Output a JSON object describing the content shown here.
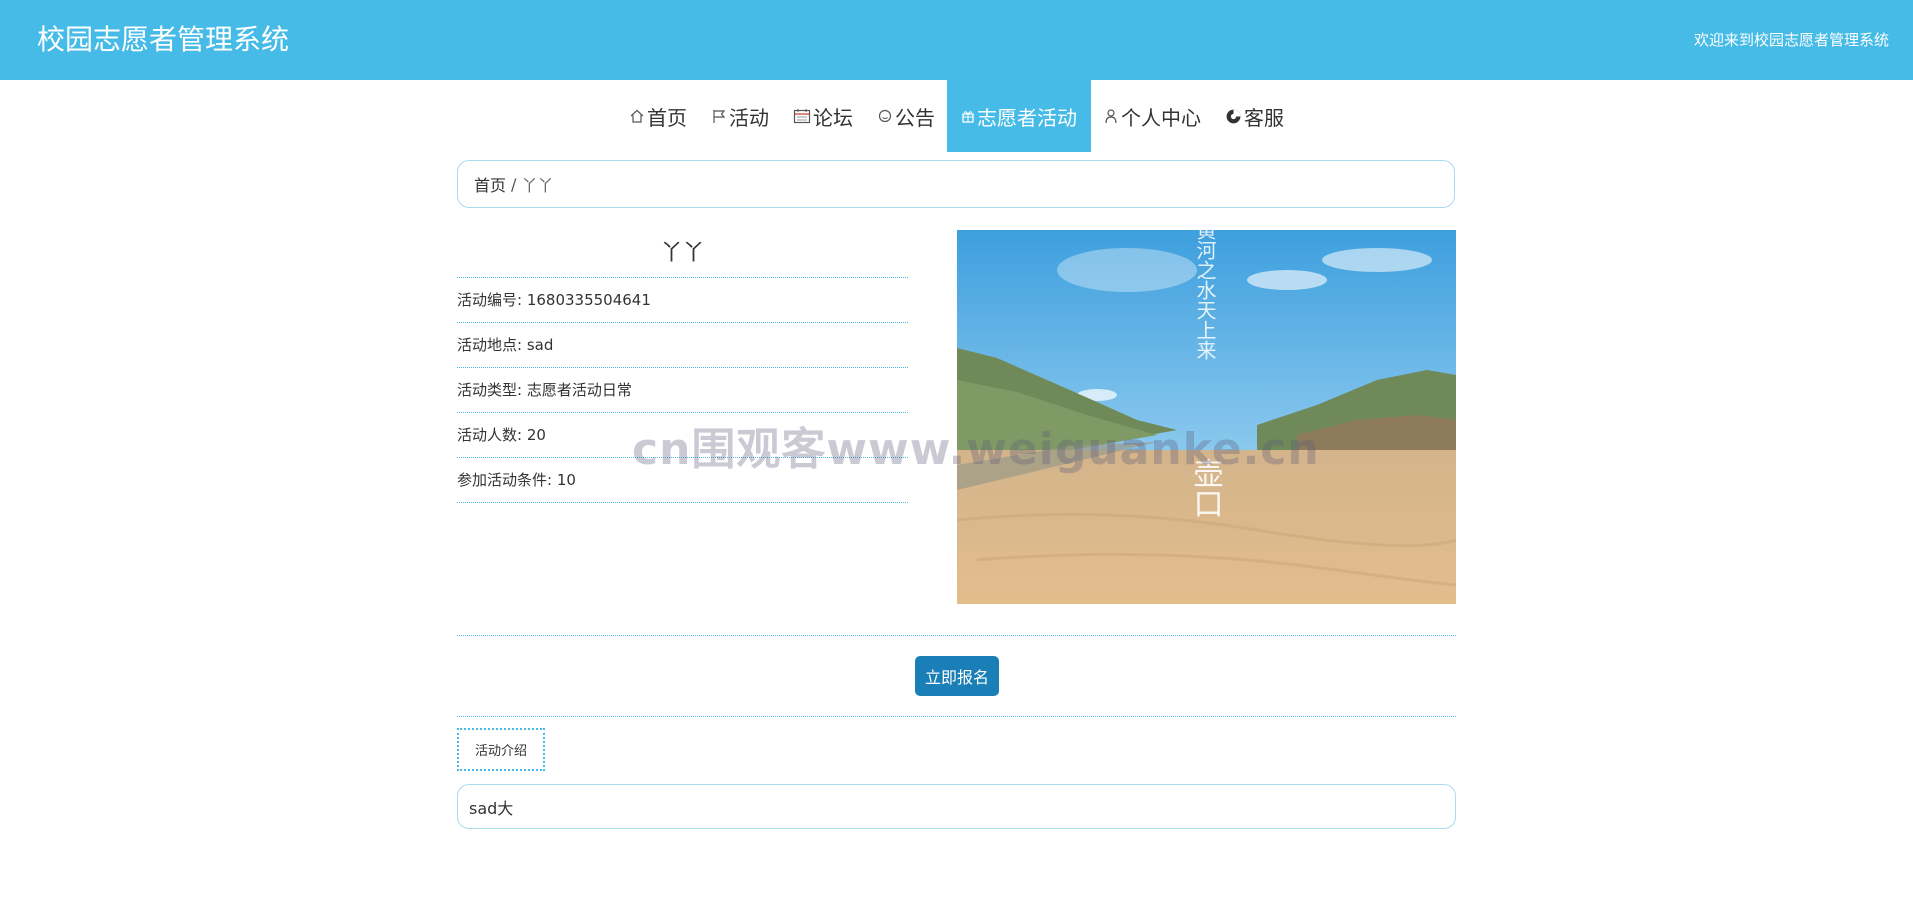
{
  "header": {
    "title": "校园志愿者管理系统",
    "welcome": "欢迎来到校园志愿者管理系统"
  },
  "nav": {
    "items": [
      {
        "label": "首页",
        "icon": "home-icon"
      },
      {
        "label": "活动",
        "icon": "flag-icon"
      },
      {
        "label": "论坛",
        "icon": "calendar-icon"
      },
      {
        "label": "公告",
        "icon": "notice-icon"
      },
      {
        "label": "志愿者活动",
        "icon": "gift-icon",
        "active": true
      },
      {
        "label": "个人中心",
        "icon": "user-icon"
      },
      {
        "label": "客服",
        "icon": "service-icon"
      }
    ]
  },
  "breadcrumb": {
    "home": "首页",
    "separator": "/",
    "current": "丫丫"
  },
  "activity": {
    "name": "丫丫",
    "fields": [
      "活动编号: 1680335504641",
      "活动地点: sad",
      "活动类型: 志愿者活动日常",
      "活动人数: 20",
      "参加活动条件: 10"
    ],
    "image_caption": "黄河之水天上来",
    "image_stamp": "壶口"
  },
  "actions": {
    "signup": "立即报名"
  },
  "tabs": {
    "intro": "活动介绍"
  },
  "intro_content": "sad大",
  "watermark": "cn围观客www.weiguanke.cn",
  "colors": {
    "primary": "#46bbe7",
    "button": "#1a7fb6",
    "border": "#a8dcef"
  }
}
